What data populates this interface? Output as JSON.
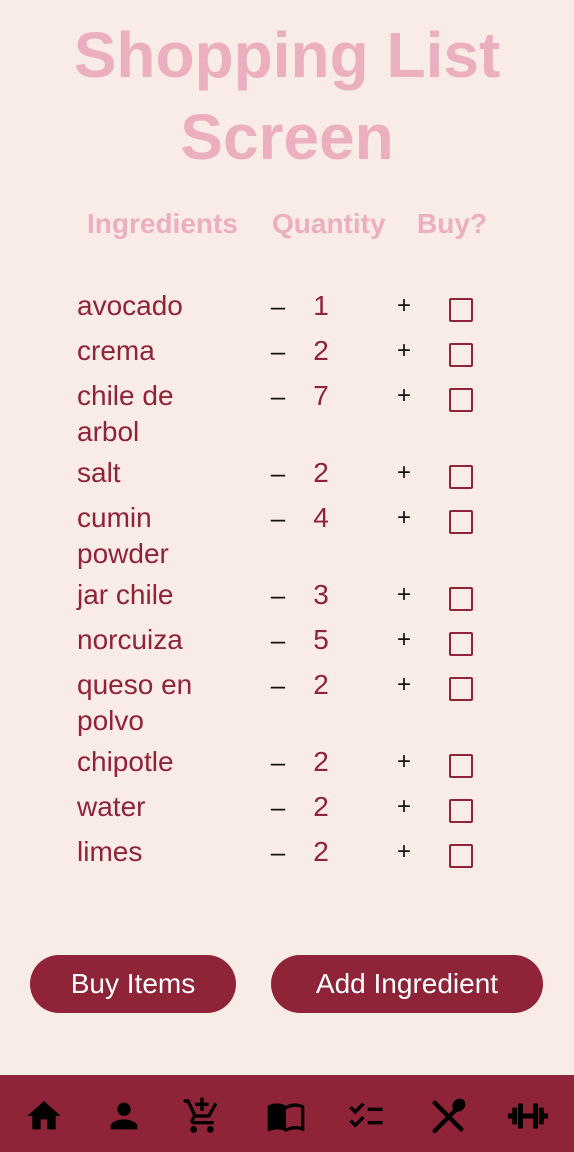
{
  "page_title_line1": "Shopping List",
  "page_title_line2": "Screen",
  "headers": {
    "ingredients": "Ingredients",
    "quantity": "Quantity",
    "buy": "Buy?"
  },
  "controls": {
    "minus": "–",
    "plus": "+"
  },
  "items": [
    {
      "name": "avocado",
      "qty": "1",
      "checked": false
    },
    {
      "name": "crema",
      "qty": "2",
      "checked": false
    },
    {
      "name": "chile de arbol",
      "qty": "7",
      "checked": false
    },
    {
      "name": "salt",
      "qty": "2",
      "checked": false
    },
    {
      "name": "cumin powder",
      "qty": "4",
      "checked": false
    },
    {
      "name": "jar chile",
      "qty": "3",
      "checked": false
    },
    {
      "name": "norcuiza",
      "qty": "5",
      "checked": false
    },
    {
      "name": "queso en polvo",
      "qty": "2",
      "checked": false
    },
    {
      "name": "chipotle",
      "qty": "2",
      "checked": false
    },
    {
      "name": "water",
      "qty": "2",
      "checked": false
    },
    {
      "name": "limes",
      "qty": "2",
      "checked": false
    }
  ],
  "buttons": {
    "buy_items": "Buy Items",
    "add_ingredient": "Add Ingredient"
  },
  "nav": [
    {
      "icon": "home-icon"
    },
    {
      "icon": "person-icon"
    },
    {
      "icon": "add-cart-icon"
    },
    {
      "icon": "book-icon"
    },
    {
      "icon": "checklist-icon"
    },
    {
      "icon": "utensils-icon"
    },
    {
      "icon": "dumbbell-icon"
    }
  ],
  "colors": {
    "background": "#f9ebe6",
    "accent": "#8f2338",
    "title_pink": "#ecafbf"
  }
}
